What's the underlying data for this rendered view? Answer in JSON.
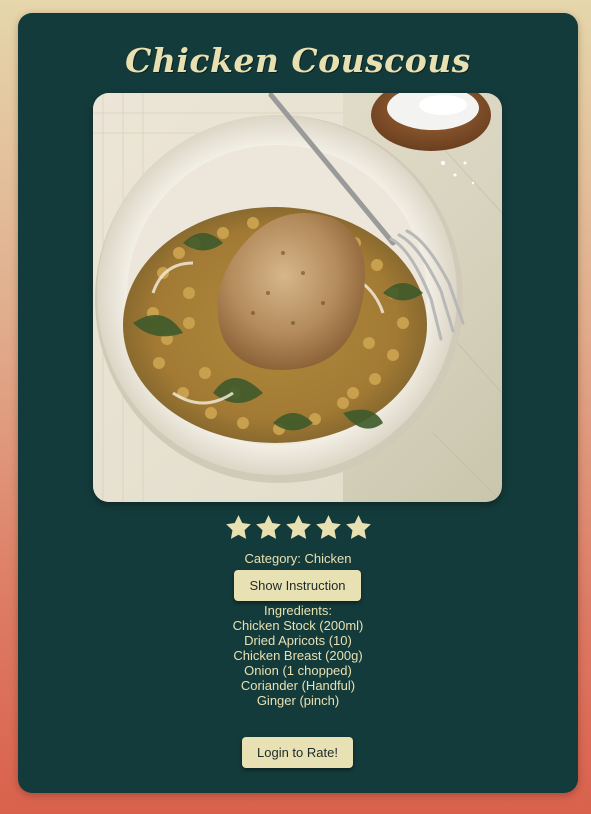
{
  "recipe": {
    "title": "Chicken Couscous",
    "rating": {
      "value": 5,
      "max": 5
    },
    "category_text": "Category: Chicken",
    "ingredients_heading": "Ingredients:",
    "ingredients": [
      "Chicken Stock (200ml)",
      "Dried Apricots (10)",
      "Chicken Breast (200g)",
      "Onion (1 chopped)",
      "Coriander (Handful)",
      "Ginger (pinch)"
    ]
  },
  "buttons": {
    "show_instruction": "Show Instruction",
    "login_to_rate": "Login to Rate!"
  },
  "colors": {
    "card_background": "#143b3b",
    "text_cream": "#e8e0b1",
    "button_background": "#e8e1b4",
    "star_fill": "#e8e0b1"
  },
  "icons": {
    "rating_star": "star-icon"
  }
}
